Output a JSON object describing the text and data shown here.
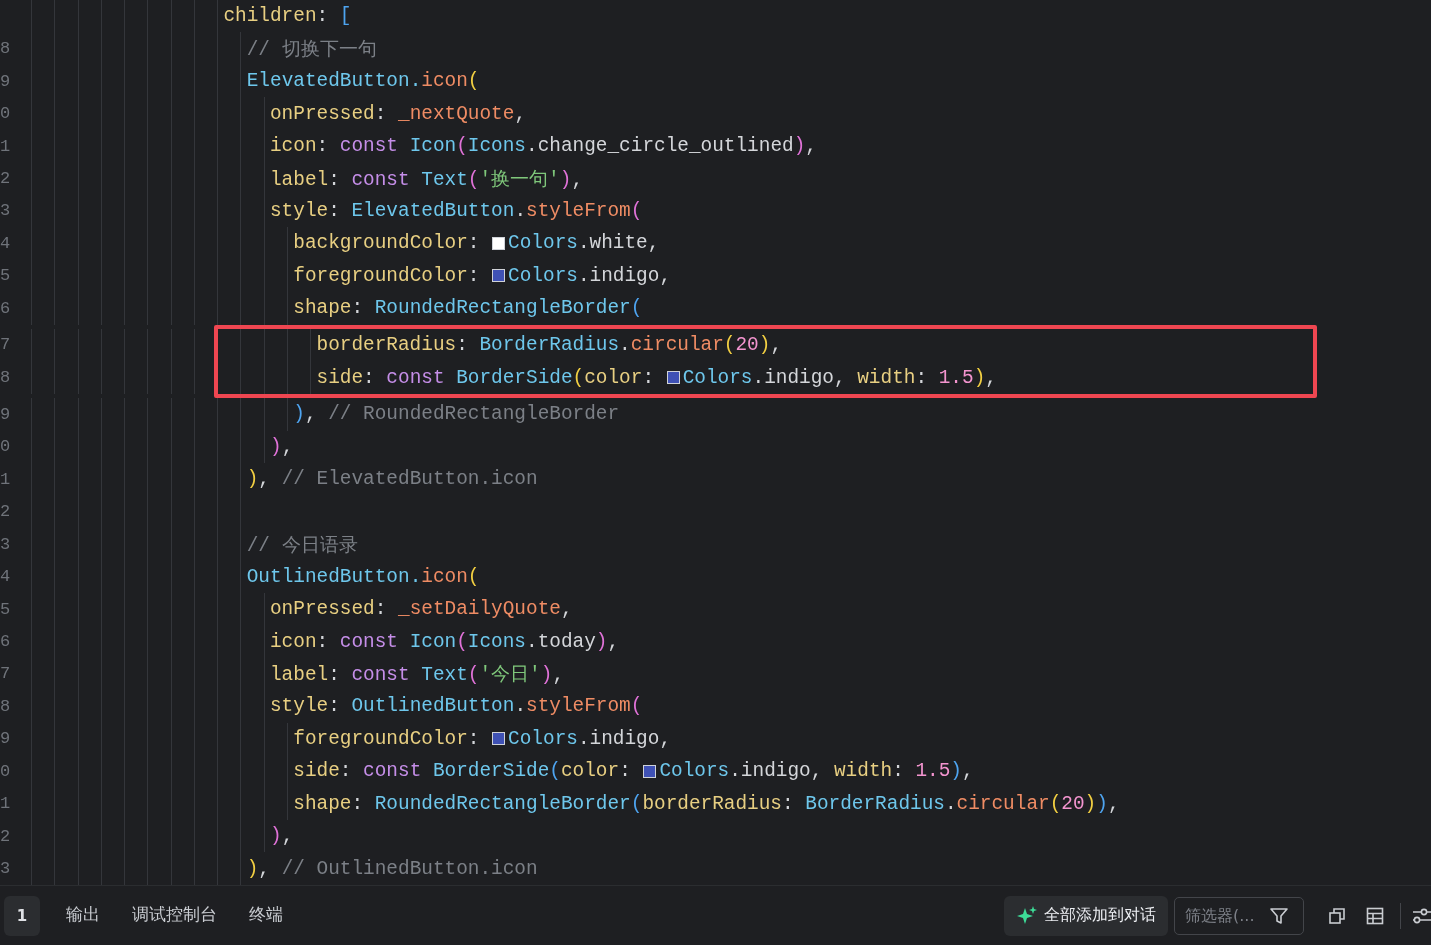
{
  "editor": {
    "lines": [
      {
        "highlighted": false,
        "tokens": [
          {
            "kind": "prop",
            "text": "                  children"
          },
          {
            "kind": "plain",
            "text": ": "
          },
          {
            "kind": "bracket3",
            "text": "["
          }
        ]
      },
      {
        "number": "8",
        "highlighted": false,
        "tokens": [
          {
            "kind": "comment",
            "text": "                    // 切换下一句"
          }
        ]
      },
      {
        "number": "9",
        "highlighted": false,
        "tokens": [
          {
            "kind": "type",
            "text": "                    ElevatedButton."
          },
          {
            "kind": "method",
            "text": "icon"
          },
          {
            "kind": "bracket1",
            "text": "("
          }
        ]
      },
      {
        "number": "0",
        "highlighted": false,
        "tokens": [
          {
            "kind": "prop",
            "text": "                      onPressed"
          },
          {
            "kind": "plain",
            "text": ": "
          },
          {
            "kind": "method",
            "text": "_nextQuote"
          },
          {
            "kind": "plain",
            "text": ","
          }
        ]
      },
      {
        "number": "1",
        "highlighted": false,
        "tokens": [
          {
            "kind": "prop",
            "text": "                      icon"
          },
          {
            "kind": "plain",
            "text": ": "
          },
          {
            "kind": "keyword",
            "text": "const "
          },
          {
            "kind": "type",
            "text": "Icon"
          },
          {
            "kind": "bracket2",
            "text": "("
          },
          {
            "kind": "type",
            "text": "Icons"
          },
          {
            "kind": "plain",
            "text": ".change_circle_outlined"
          },
          {
            "kind": "bracket2",
            "text": ")"
          },
          {
            "kind": "plain",
            "text": ","
          }
        ]
      },
      {
        "number": "2",
        "highlighted": false,
        "tokens": [
          {
            "kind": "prop",
            "text": "                      label"
          },
          {
            "kind": "plain",
            "text": ": "
          },
          {
            "kind": "keyword",
            "text": "const "
          },
          {
            "kind": "type",
            "text": "Text"
          },
          {
            "kind": "bracket2",
            "text": "("
          },
          {
            "kind": "string",
            "text": "'换一句'"
          },
          {
            "kind": "bracket2",
            "text": ")"
          },
          {
            "kind": "plain",
            "text": ","
          }
        ]
      },
      {
        "number": "3",
        "highlighted": false,
        "tokens": [
          {
            "kind": "prop",
            "text": "                      style"
          },
          {
            "kind": "plain",
            "text": ": "
          },
          {
            "kind": "type",
            "text": "ElevatedButton"
          },
          {
            "kind": "plain",
            "text": "."
          },
          {
            "kind": "method",
            "text": "styleFrom"
          },
          {
            "kind": "bracket2",
            "text": "("
          }
        ]
      },
      {
        "number": "4",
        "highlighted": false,
        "tokens": [
          {
            "kind": "prop",
            "text": "                        backgroundColor"
          },
          {
            "kind": "plain",
            "text": ": "
          },
          {
            "kind": "swatch",
            "color": "#ffffff"
          },
          {
            "kind": "type",
            "text": "Colors"
          },
          {
            "kind": "plain",
            "text": ".white,"
          }
        ]
      },
      {
        "number": "5",
        "highlighted": false,
        "tokens": [
          {
            "kind": "prop",
            "text": "                        foregroundColor"
          },
          {
            "kind": "plain",
            "text": ": "
          },
          {
            "kind": "swatch",
            "color": "#3f51b5"
          },
          {
            "kind": "type",
            "text": "Colors"
          },
          {
            "kind": "plain",
            "text": ".indigo,"
          }
        ]
      },
      {
        "number": "6",
        "highlighted": false,
        "tokens": [
          {
            "kind": "prop",
            "text": "                        shape"
          },
          {
            "kind": "plain",
            "text": ": "
          },
          {
            "kind": "type",
            "text": "RoundedRectangleBorder"
          },
          {
            "kind": "bracket3",
            "text": "("
          }
        ]
      },
      {
        "number": "7",
        "highlighted": true,
        "tokens": [
          {
            "kind": "prop",
            "text": "                          borderRadius"
          },
          {
            "kind": "plain",
            "text": ": "
          },
          {
            "kind": "type",
            "text": "BorderRadius"
          },
          {
            "kind": "plain",
            "text": "."
          },
          {
            "kind": "method",
            "text": "circular"
          },
          {
            "kind": "bracket1",
            "text": "("
          },
          {
            "kind": "number",
            "text": "20"
          },
          {
            "kind": "bracket1",
            "text": ")"
          },
          {
            "kind": "plain",
            "text": ","
          }
        ]
      },
      {
        "number": "8",
        "highlighted": true,
        "tokens": [
          {
            "kind": "prop",
            "text": "                          side"
          },
          {
            "kind": "plain",
            "text": ": "
          },
          {
            "kind": "keyword",
            "text": "const "
          },
          {
            "kind": "type",
            "text": "BorderSide"
          },
          {
            "kind": "bracket1",
            "text": "("
          },
          {
            "kind": "prop",
            "text": "color"
          },
          {
            "kind": "plain",
            "text": ": "
          },
          {
            "kind": "swatch",
            "color": "#3f51b5"
          },
          {
            "kind": "type",
            "text": "Colors"
          },
          {
            "kind": "plain",
            "text": ".indigo, "
          },
          {
            "kind": "prop",
            "text": "width"
          },
          {
            "kind": "plain",
            "text": ": "
          },
          {
            "kind": "number",
            "text": "1.5"
          },
          {
            "kind": "bracket1",
            "text": ")"
          },
          {
            "kind": "plain",
            "text": ","
          }
        ]
      },
      {
        "number": "9",
        "highlighted": false,
        "tokens": [
          {
            "kind": "bracket3",
            "text": "                        )"
          },
          {
            "kind": "plain",
            "text": ", "
          },
          {
            "kind": "comment",
            "text": "// RoundedRectangleBorder"
          }
        ]
      },
      {
        "number": "0",
        "highlighted": false,
        "tokens": [
          {
            "kind": "bracket2",
            "text": "                      )"
          },
          {
            "kind": "plain",
            "text": ","
          }
        ]
      },
      {
        "number": "1",
        "highlighted": false,
        "tokens": [
          {
            "kind": "bracket1",
            "text": "                    )"
          },
          {
            "kind": "plain",
            "text": ", "
          },
          {
            "kind": "comment",
            "text": "// ElevatedButton.icon"
          }
        ]
      },
      {
        "number": "2",
        "highlighted": false
      },
      {
        "number": "3",
        "highlighted": false,
        "tokens": [
          {
            "kind": "comment",
            "text": "                    // 今日语录"
          }
        ]
      },
      {
        "number": "4",
        "highlighted": false,
        "tokens": [
          {
            "kind": "type",
            "text": "                    OutlinedButton."
          },
          {
            "kind": "method",
            "text": "icon"
          },
          {
            "kind": "bracket1",
            "text": "("
          }
        ]
      },
      {
        "number": "5",
        "highlighted": false,
        "tokens": [
          {
            "kind": "prop",
            "text": "                      onPressed"
          },
          {
            "kind": "plain",
            "text": ": "
          },
          {
            "kind": "method",
            "text": "_setDailyQuote"
          },
          {
            "kind": "plain",
            "text": ","
          }
        ]
      },
      {
        "number": "6",
        "highlighted": false,
        "tokens": [
          {
            "kind": "prop",
            "text": "                      icon"
          },
          {
            "kind": "plain",
            "text": ": "
          },
          {
            "kind": "keyword",
            "text": "const "
          },
          {
            "kind": "type",
            "text": "Icon"
          },
          {
            "kind": "bracket2",
            "text": "("
          },
          {
            "kind": "type",
            "text": "Icons"
          },
          {
            "kind": "plain",
            "text": ".today"
          },
          {
            "kind": "bracket2",
            "text": ")"
          },
          {
            "kind": "plain",
            "text": ","
          }
        ]
      },
      {
        "number": "7",
        "highlighted": false,
        "tokens": [
          {
            "kind": "prop",
            "text": "                      label"
          },
          {
            "kind": "plain",
            "text": ": "
          },
          {
            "kind": "keyword",
            "text": "const "
          },
          {
            "kind": "type",
            "text": "Text"
          },
          {
            "kind": "bracket2",
            "text": "("
          },
          {
            "kind": "string",
            "text": "'今日'"
          },
          {
            "kind": "bracket2",
            "text": ")"
          },
          {
            "kind": "plain",
            "text": ","
          }
        ]
      },
      {
        "number": "8",
        "highlighted": false,
        "tokens": [
          {
            "kind": "prop",
            "text": "                      style"
          },
          {
            "kind": "plain",
            "text": ": "
          },
          {
            "kind": "type",
            "text": "OutlinedButton"
          },
          {
            "kind": "plain",
            "text": "."
          },
          {
            "kind": "method",
            "text": "styleFrom"
          },
          {
            "kind": "bracket2",
            "text": "("
          }
        ]
      },
      {
        "number": "9",
        "highlighted": false,
        "tokens": [
          {
            "kind": "prop",
            "text": "                        foregroundColor"
          },
          {
            "kind": "plain",
            "text": ": "
          },
          {
            "kind": "swatch",
            "color": "#3f51b5"
          },
          {
            "kind": "type",
            "text": "Colors"
          },
          {
            "kind": "plain",
            "text": ".indigo,"
          }
        ]
      },
      {
        "number": "0",
        "highlighted": false,
        "tokens": [
          {
            "kind": "prop",
            "text": "                        side"
          },
          {
            "kind": "plain",
            "text": ": "
          },
          {
            "kind": "keyword",
            "text": "const "
          },
          {
            "kind": "type",
            "text": "BorderSide"
          },
          {
            "kind": "bracket3",
            "text": "("
          },
          {
            "kind": "prop",
            "text": "color"
          },
          {
            "kind": "plain",
            "text": ": "
          },
          {
            "kind": "swatch",
            "color": "#3f51b5"
          },
          {
            "kind": "type",
            "text": "Colors"
          },
          {
            "kind": "plain",
            "text": ".indigo, "
          },
          {
            "kind": "prop",
            "text": "width"
          },
          {
            "kind": "plain",
            "text": ": "
          },
          {
            "kind": "number",
            "text": "1.5"
          },
          {
            "kind": "bracket3",
            "text": ")"
          },
          {
            "kind": "plain",
            "text": ","
          }
        ]
      },
      {
        "number": "1",
        "highlighted": false,
        "tokens": [
          {
            "kind": "prop",
            "text": "                        shape"
          },
          {
            "kind": "plain",
            "text": ": "
          },
          {
            "kind": "type",
            "text": "RoundedRectangleBorder"
          },
          {
            "kind": "bracket3",
            "text": "("
          },
          {
            "kind": "prop",
            "text": "borderRadius"
          },
          {
            "kind": "plain",
            "text": ": "
          },
          {
            "kind": "type",
            "text": "BorderRadius"
          },
          {
            "kind": "plain",
            "text": "."
          },
          {
            "kind": "method",
            "text": "circular"
          },
          {
            "kind": "bracket1",
            "text": "("
          },
          {
            "kind": "number",
            "text": "20"
          },
          {
            "kind": "bracket1",
            "text": ")"
          },
          {
            "kind": "bracket3",
            "text": ")"
          },
          {
            "kind": "plain",
            "text": ","
          }
        ]
      },
      {
        "number": "2",
        "highlighted": false,
        "tokens": [
          {
            "kind": "bracket2",
            "text": "                      )"
          },
          {
            "kind": "plain",
            "text": ","
          }
        ]
      },
      {
        "number": "3",
        "highlighted": false,
        "tokens": [
          {
            "kind": "bracket1",
            "text": "                    )"
          },
          {
            "kind": "plain",
            "text": ", "
          },
          {
            "kind": "comment",
            "text": "// OutlinedButton.icon"
          }
        ]
      }
    ]
  },
  "panel": {
    "badge": "1",
    "tabs": [
      {
        "label": "输出",
        "selected": false
      },
      {
        "label": "调试控制台",
        "selected": false
      },
      {
        "label": "终端",
        "selected": false
      }
    ],
    "add_button": "全部添加到对话",
    "filter": {
      "placeholder": "筛选器(..."
    }
  }
}
